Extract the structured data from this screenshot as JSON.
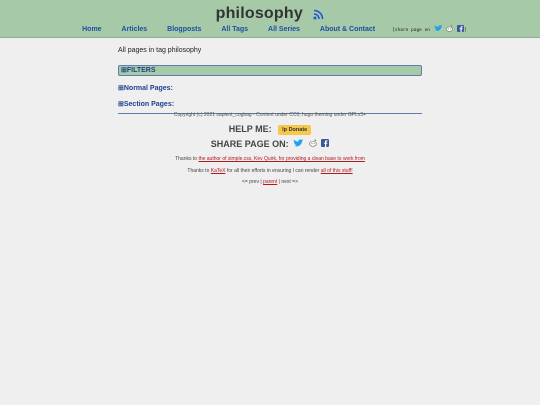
{
  "site": {
    "title": "philosophy"
  },
  "nav": {
    "items": [
      {
        "label": "Home"
      },
      {
        "label": "Articles"
      },
      {
        "label": "Blogposts"
      },
      {
        "label": "All Tags"
      },
      {
        "label": "All Series"
      },
      {
        "label": "About & Contact"
      }
    ],
    "share_label": "share page on"
  },
  "main": {
    "subtitle": "All pages in tag philosophy",
    "filters_label": "⊞FILTERS",
    "normal_pages_label": "⊞Normal Pages:",
    "section_pages_label": "⊞Section Pages:"
  },
  "footer": {
    "copyright": "Copyright (c) 2021 sapient_cogbag - Content under CC0, hugo theming under GPLv3+",
    "help_label": "HELP ME:",
    "donate_label": "Donate",
    "share_label": "SHARE PAGE ON:",
    "thanks1_prefix": "Thanks to ",
    "thanks1_link": "the author of simple.css, Kev Quirk, for providing a clean base to work from",
    "thanks2_prefix": "Thanks to ",
    "thanks2_link1": "KaTeX",
    "thanks2_mid": " for all their efforts in ensuring I can render ",
    "thanks2_link2": "all of this stuff!",
    "pager_prev": "<= prev",
    "pager_sep1": " | ",
    "pager_parent": "parent",
    "pager_sep2": " | ",
    "pager_next": "next =>"
  },
  "colors": {
    "header_bg": "#a6c9a7",
    "link_blue": "#1f4ea3",
    "link_red": "#b0181c",
    "donate_bg": "#f7c74b",
    "rss_blue": "#1d5bd6"
  }
}
